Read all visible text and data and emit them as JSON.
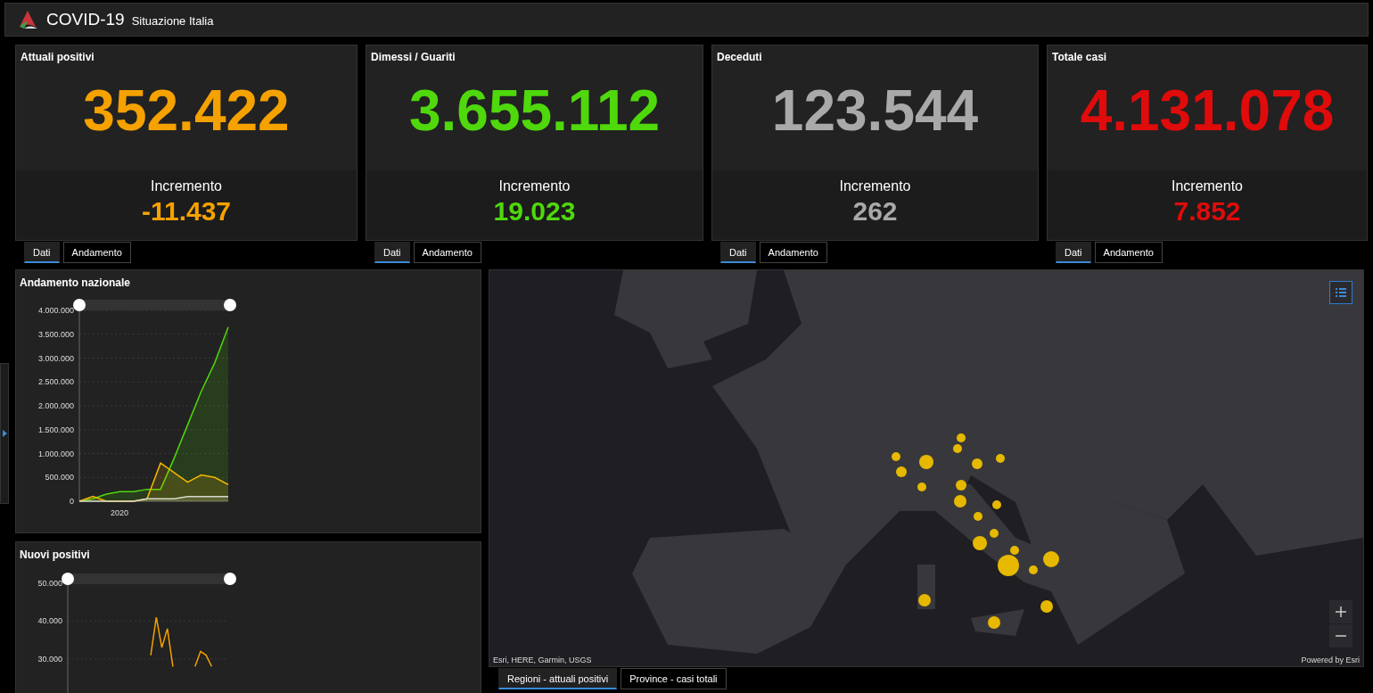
{
  "header": {
    "title": "COVID-19",
    "subtitle": "Situazione Italia"
  },
  "cards": [
    {
      "title": "Attuali positivi",
      "value": "352.422",
      "increment_label": "Incremento",
      "increment": "-11.437",
      "color": "#f5a100",
      "tabs": [
        {
          "label": "Dati",
          "selected": true
        },
        {
          "label": "Andamento",
          "selected": false
        }
      ]
    },
    {
      "title": "Dimessi / Guariti",
      "value": "3.655.112",
      "increment_label": "Incremento",
      "increment": "19.023",
      "color": "#4fd80c",
      "tabs": [
        {
          "label": "Dati",
          "selected": true
        },
        {
          "label": "Andamento",
          "selected": false
        }
      ]
    },
    {
      "title": "Deceduti",
      "value": "123.544",
      "increment_label": "Incremento",
      "increment": "262",
      "color": "#a9a9a9",
      "tabs": [
        {
          "label": "Dati",
          "selected": true
        },
        {
          "label": "Andamento",
          "selected": false
        }
      ]
    },
    {
      "title": "Totale casi",
      "value": "4.131.078",
      "increment_label": "Incremento",
      "increment": "7.852",
      "color": "#e00b0b",
      "tabs": [
        {
          "label": "Dati",
          "selected": true
        },
        {
          "label": "Andamento",
          "selected": false
        }
      ]
    }
  ],
  "trend_panel": {
    "title": "Andamento nazionale",
    "chart_data": {
      "type": "area",
      "categories": [
        null,
        null,
        null,
        null,
        null,
        null,
        null,
        null,
        null,
        null,
        null,
        null
      ],
      "annotations": [
        "2020"
      ],
      "grid": true,
      "ylim": [
        0,
        4000000
      ],
      "yticks": [
        {
          "value": 0,
          "label": "0"
        },
        {
          "value": 500000,
          "label": "500.000"
        },
        {
          "value": 1000000,
          "label": "1.000.000"
        },
        {
          "value": 1500000,
          "label": "1.500.000"
        },
        {
          "value": 2000000,
          "label": "2.000.000"
        },
        {
          "value": 2500000,
          "label": "2.500.000"
        },
        {
          "value": 3000000,
          "label": "3.000.000"
        },
        {
          "value": 3500000,
          "label": "3.500.000"
        },
        {
          "value": 4000000,
          "label": "4.000.000"
        }
      ],
      "series": [
        {
          "color": "#4fd80c",
          "values": [
            0,
            50000,
            150000,
            200000,
            200000,
            250000,
            250000,
            900000,
            1600000,
            2300000,
            2900000,
            3650000
          ]
        },
        {
          "color": "#f5b800",
          "values": [
            0,
            100000,
            0,
            0,
            0,
            50000,
            800000,
            600000,
            400000,
            550000,
            500000,
            350000
          ]
        },
        {
          "color": "#d8d8cc",
          "values": [
            0,
            0,
            0,
            0,
            0,
            50000,
            50000,
            50000,
            100000,
            100000,
            100000,
            100000
          ]
        }
      ]
    }
  },
  "new_cases_panel": {
    "title": "Nuovi positivi",
    "chart_data": {
      "type": "line",
      "categories": [
        null,
        null,
        null,
        null,
        null,
        null,
        null,
        null,
        null,
        null,
        null,
        null,
        null,
        null,
        null,
        null,
        null,
        null,
        null,
        null,
        null,
        null,
        null,
        null,
        null,
        null,
        null,
        null,
        null,
        null
      ],
      "grid": true,
      "ylim": [
        0,
        50000
      ],
      "yticks": [
        {
          "value": 30000,
          "label": "30.000"
        },
        {
          "value": 40000,
          "label": "40.000"
        },
        {
          "value": 50000,
          "label": "50.000"
        }
      ],
      "series": [
        {
          "color": "#f5a100",
          "values": [
            null,
            null,
            null,
            null,
            null,
            null,
            null,
            null,
            null,
            null,
            null,
            null,
            null,
            null,
            null,
            31000,
            41000,
            33000,
            38000,
            28000,
            null,
            null,
            null,
            28000,
            32000,
            31000,
            28000,
            null,
            null,
            null
          ]
        }
      ]
    }
  },
  "map": {
    "attribution": "Esri, HERE, Garmin, USGS",
    "powered_by": "Powered by Esri",
    "tabs": [
      {
        "label": "Regioni - attuali positivi",
        "selected": true
      },
      {
        "label": "Province - casi totali",
        "selected": false
      }
    ]
  }
}
